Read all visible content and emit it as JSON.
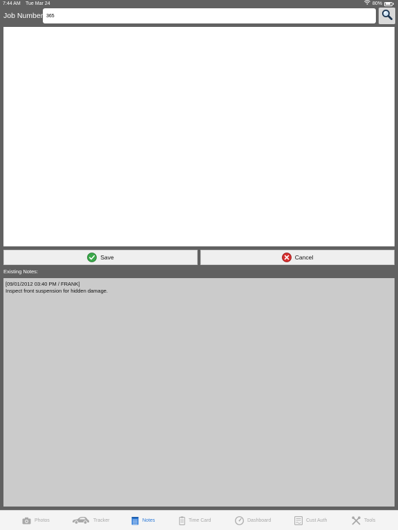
{
  "status_bar": {
    "time": "7:44 AM",
    "date": "Tue Mar 24",
    "battery": "80%",
    "battery_level": 0.8
  },
  "header": {
    "job_label": "Job Number",
    "job_value": "365",
    "search_icon": "magnifier-icon"
  },
  "note_editor": {
    "value": ""
  },
  "actions": {
    "save_label": "Save",
    "save_icon": "check-circle-icon",
    "cancel_label": "Cancel",
    "cancel_icon": "x-circle-icon"
  },
  "existing": {
    "label": "Existing Notes:",
    "notes": [
      {
        "header": "[09/01/2012 03:40 PM / FRANK]",
        "text": "Inspect front suspension for hidden damage."
      }
    ]
  },
  "tabs": [
    {
      "label": "Photos",
      "icon": "camera-icon",
      "active": false
    },
    {
      "label": "Tracker",
      "icon": "car-icon",
      "active": false
    },
    {
      "label": "Notes",
      "icon": "notepad-icon",
      "active": true
    },
    {
      "label": "Time Card",
      "icon": "timecard-icon",
      "active": false
    },
    {
      "label": "Dashboard",
      "icon": "gauge-icon",
      "active": false
    },
    {
      "label": "Cust Auth",
      "icon": "document-icon",
      "active": false
    },
    {
      "label": "Tools",
      "icon": "tools-icon",
      "active": false
    }
  ],
  "colors": {
    "background": "#616161",
    "active_tab": "#2f7bd8",
    "inactive_tab": "#a8a8a8",
    "notes_bg": "#cbcbcb"
  }
}
